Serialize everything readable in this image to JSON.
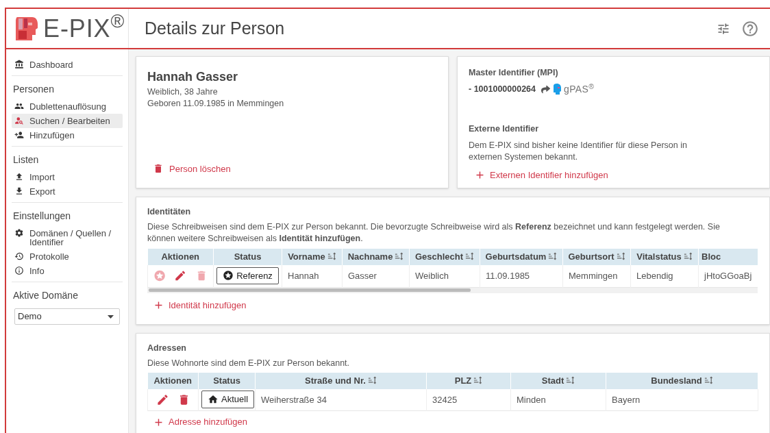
{
  "header": {
    "logo": "E-PIX$^{®}$",
    "page_title": "Details zur Person"
  },
  "sidebar": {
    "sections": [
      {
        "items": [
          {
            "label": "Dashboard",
            "selected": false
          }
        ]
      },
      {
        "heading": "Personen",
        "items": [
          {
            "label": "Dublettenauflösung",
            "selected": false
          },
          {
            "label": "Suchen / Bearbeiten",
            "selected": true
          },
          {
            "label": "Hinzufügen",
            "selected": false
          }
        ]
      },
      {
        "heading": "Listen",
        "items": [
          {
            "label": "Import",
            "selected": false
          },
          {
            "label": "Export",
            "selected": false
          }
        ]
      },
      {
        "heading": "Einstellungen",
        "items": [
          {
            "label": "Domänen / Quellen / Identifier",
            "selected": false
          },
          {
            "label": "Protokolle",
            "selected": false
          },
          {
            "label": "Info",
            "selected": false
          }
        ]
      }
    ],
    "active_domain": {
      "label": "Aktive Domäne",
      "value": "Demo"
    }
  },
  "person": {
    "name": "Hannah Gasser",
    "lines": [
      "Weiblich, 38 Jahre",
      "Geboren 11.09.1985 in Memmingen"
    ],
    "delete_link": "Person löschen"
  },
  "identifiers": {
    "mpi_heading": "Master Identifier (MPI)",
    "mpi_value": "- 1001000000264",
    "gpas_logo": "gPAS$^{®}$",
    "external_heading": "Externe Identifier",
    "external_text": "Dem E-PIX sind bisher keine Identifier für diese Person in externen Systemen bekannt.",
    "add_link": "Externen Identifier hinzufügen"
  },
  "identities": {
    "heading": "Identitäten",
    "description": "Diese Schreibweisen sind dem E-PIX zur Person bekannt. Die bevorzugte Schreibweise wird als **Referenz** bezeichnet und kann festgelegt werden. Sie können weitere Schreibweisen als **Identität hinzufügen**.",
    "columns": [
      {
        "label": "Aktionen",
        "sortable": false
      },
      {
        "label": "Status",
        "sortable": false
      },
      {
        "label": "Vorname",
        "sortable": true
      },
      {
        "label": "Nachname",
        "sortable": true
      },
      {
        "label": "Geschlecht",
        "sortable": true
      },
      {
        "label": "Geburtsdatum",
        "sortable": true
      },
      {
        "label": "Geburtsort",
        "sortable": true
      },
      {
        "label": "Vitalstatus",
        "sortable": true
      },
      {
        "label": "Bloc",
        "sortable": false
      }
    ],
    "rows": [
      {
        "cells": [
          {
            "kind": "actions",
            "actions": [
              {
                "kind": "star",
                "disabled": true
              },
              {
                "kind": "edit",
                "disabled": false
              },
              {
                "kind": "delete",
                "disabled": true
              }
            ]
          },
          {
            "kind": "status",
            "button": {
              "kind": "reference",
              "label": "Referenz"
            }
          },
          {
            "kind": "text",
            "text": "Hannah"
          },
          {
            "kind": "text",
            "text": "Gasser"
          },
          {
            "kind": "text",
            "text": "Weiblich"
          },
          {
            "kind": "text",
            "text": "11.09.1985"
          },
          {
            "kind": "text",
            "text": "Memmingen"
          },
          {
            "kind": "text",
            "text": "Lebendig"
          },
          {
            "kind": "text",
            "text": "jHtoGGoaBj"
          }
        ]
      }
    ],
    "add_link": "Identität hinzufügen"
  },
  "addresses": {
    "heading": "Adressen",
    "description": "Diese Wohnorte sind dem E-PIX zur Person bekannt.",
    "columns": [
      {
        "label": "Aktionen",
        "sortable": false
      },
      {
        "label": "Status",
        "sortable": false
      },
      {
        "label": "Straße und Nr.",
        "sortable": true
      },
      {
        "label": "PLZ",
        "sortable": true
      },
      {
        "label": "Stadt",
        "sortable": true
      },
      {
        "label": "Bundesland",
        "sortable": true
      }
    ],
    "rows": [
      {
        "cells": [
          {
            "kind": "actions",
            "actions": [
              {
                "kind": "edit",
                "disabled": false
              },
              {
                "kind": "delete",
                "disabled": false
              }
            ]
          },
          {
            "kind": "status",
            "button": {
              "kind": "current",
              "label": "Aktuell"
            }
          },
          {
            "kind": "text",
            "text": "Weiherstraße 34"
          },
          {
            "kind": "text",
            "text": "32425"
          },
          {
            "kind": "text",
            "text": "Minden"
          },
          {
            "kind": "text",
            "text": "Bayern"
          }
        ]
      }
    ],
    "add_link": "Adresse hinzufügen"
  }
}
